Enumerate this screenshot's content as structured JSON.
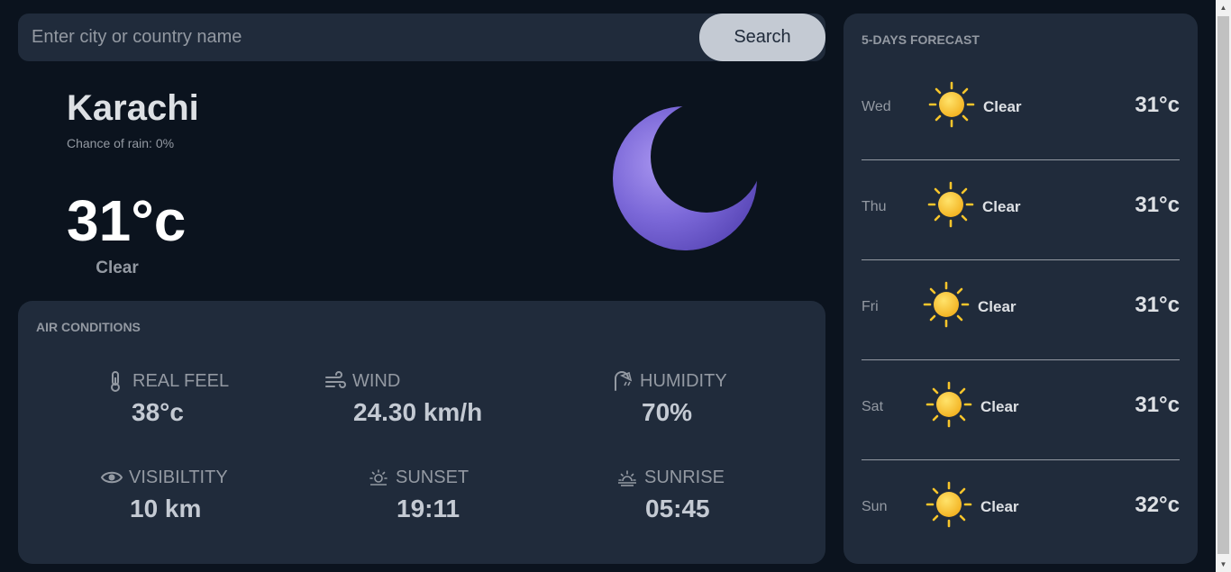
{
  "search": {
    "placeholder": "Enter city or country name",
    "button_label": "Search"
  },
  "current": {
    "city": "Karachi",
    "rain_chance": "Chance of rain: 0%",
    "temperature": "31°c",
    "condition": "Clear",
    "icon": "moon-icon"
  },
  "air_conditions": {
    "title": "AIR CONDITIONS",
    "metrics": [
      {
        "label": "REAL FEEL",
        "value": "38°c",
        "icon": "thermometer-icon"
      },
      {
        "label": "WIND",
        "value": "24.30 km/h",
        "icon": "wind-icon"
      },
      {
        "label": "HUMIDITY",
        "value": "70%",
        "icon": "humidity-icon"
      },
      {
        "label": "VISIBILTITY",
        "value": "10 km",
        "icon": "eye-icon"
      },
      {
        "label": "SUNSET",
        "value": "19:11",
        "icon": "sunset-icon"
      },
      {
        "label": "SUNRISE",
        "value": "05:45",
        "icon": "sunrise-icon"
      }
    ]
  },
  "forecast": {
    "title": "5-DAYS FORECAST",
    "days": [
      {
        "day": "Wed",
        "condition": "Clear",
        "temp": "31°c",
        "icon": "sun-icon"
      },
      {
        "day": "Thu",
        "condition": "Clear",
        "temp": "31°c",
        "icon": "sun-icon"
      },
      {
        "day": "Fri",
        "condition": "Clear",
        "temp": "31°c",
        "icon": "sun-icon"
      },
      {
        "day": "Sat",
        "condition": "Clear",
        "temp": "31°c",
        "icon": "sun-icon"
      },
      {
        "day": "Sun",
        "condition": "Clear",
        "temp": "32°c",
        "icon": "sun-icon"
      }
    ]
  },
  "colors": {
    "background": "#0b131e",
    "panel": "#202b3b",
    "muted_text": "#9399a2",
    "moon": "#7b68d8",
    "sun": "#f7c52b"
  }
}
